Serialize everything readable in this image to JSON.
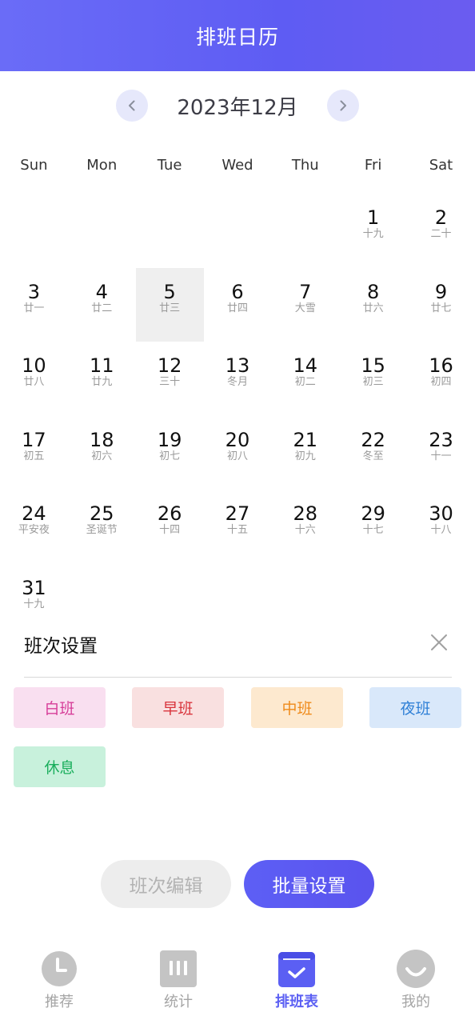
{
  "header": {
    "title": "排班日历"
  },
  "month_nav": {
    "label": "2023年12月"
  },
  "weekdays": [
    "Sun",
    "Mon",
    "Tue",
    "Wed",
    "Thu",
    "Fri",
    "Sat"
  ],
  "calendar": {
    "leading_blanks": 5,
    "today": "5",
    "days": [
      {
        "day": "1",
        "lunar": "十九"
      },
      {
        "day": "2",
        "lunar": "二十"
      },
      {
        "day": "3",
        "lunar": "廿一"
      },
      {
        "day": "4",
        "lunar": "廿二"
      },
      {
        "day": "5",
        "lunar": "廿三"
      },
      {
        "day": "6",
        "lunar": "廿四"
      },
      {
        "day": "7",
        "lunar": "大雪"
      },
      {
        "day": "8",
        "lunar": "廿六"
      },
      {
        "day": "9",
        "lunar": "廿七"
      },
      {
        "day": "10",
        "lunar": "廿八"
      },
      {
        "day": "11",
        "lunar": "廿九"
      },
      {
        "day": "12",
        "lunar": "三十"
      },
      {
        "day": "13",
        "lunar": "冬月"
      },
      {
        "day": "14",
        "lunar": "初二"
      },
      {
        "day": "15",
        "lunar": "初三"
      },
      {
        "day": "16",
        "lunar": "初四"
      },
      {
        "day": "17",
        "lunar": "初五"
      },
      {
        "day": "18",
        "lunar": "初六"
      },
      {
        "day": "19",
        "lunar": "初七"
      },
      {
        "day": "20",
        "lunar": "初八"
      },
      {
        "day": "21",
        "lunar": "初九"
      },
      {
        "day": "22",
        "lunar": "冬至"
      },
      {
        "day": "23",
        "lunar": "十一"
      },
      {
        "day": "24",
        "lunar": "平安夜"
      },
      {
        "day": "25",
        "lunar": "圣诞节"
      },
      {
        "day": "26",
        "lunar": "十四"
      },
      {
        "day": "27",
        "lunar": "十五"
      },
      {
        "day": "28",
        "lunar": "十六"
      },
      {
        "day": "29",
        "lunar": "十七"
      },
      {
        "day": "30",
        "lunar": "十八"
      },
      {
        "day": "31",
        "lunar": "十九"
      }
    ]
  },
  "shift_settings": {
    "title": "班次设置",
    "shifts": [
      {
        "label": "白班",
        "bg": "#f9dff0",
        "fg": "#d63c98"
      },
      {
        "label": "早班",
        "bg": "#f9e0e0",
        "fg": "#d9343c"
      },
      {
        "label": "中班",
        "bg": "#fde9cf",
        "fg": "#ef8a1a"
      },
      {
        "label": "夜班",
        "bg": "#d9e8fa",
        "fg": "#2e7fd6"
      },
      {
        "label": "休息",
        "bg": "#c8f1dc",
        "fg": "#1aae5c"
      }
    ],
    "edit_button": "班次编辑",
    "batch_button": "批量设置"
  },
  "tabbar": {
    "tabs": [
      {
        "label": "推荐",
        "icon": "clock-icon"
      },
      {
        "label": "统计",
        "icon": "bar-stats-icon"
      },
      {
        "label": "排班表",
        "icon": "calendar-check-icon"
      },
      {
        "label": "我的",
        "icon": "smile-icon"
      }
    ],
    "active_index": 2
  },
  "colors": {
    "accent": "#5b5ff3",
    "header_gradient_start": "#6a6cf7",
    "header_gradient_end": "#6b5cf0",
    "today_bg": "#efefef",
    "tab_inactive": "#a5a5a5"
  }
}
